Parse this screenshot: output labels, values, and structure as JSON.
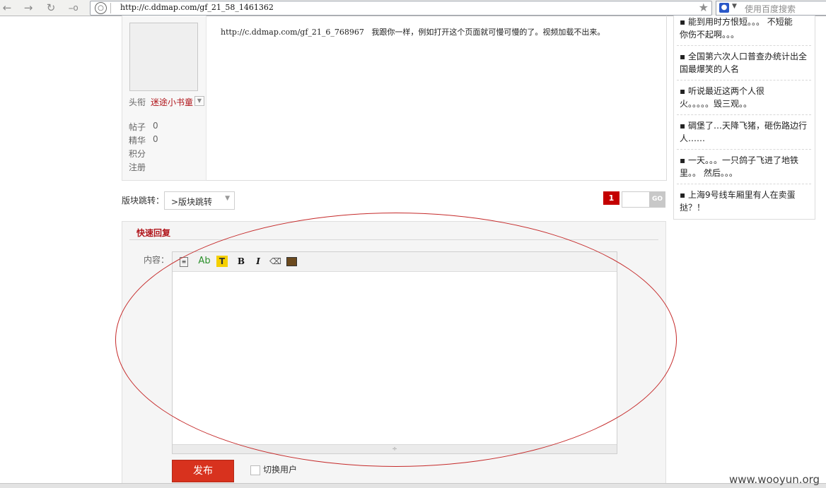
{
  "browser": {
    "url": "http://c.ddmap.com/gf_21_58_1461362",
    "search_placeholder": "使用百度搜索",
    "icons": [
      "back-arrow-icon",
      "forward-arrow-icon",
      "reload-icon",
      "key-icon",
      "globe-icon",
      "star-icon",
      "baidu-paw-icon"
    ]
  },
  "profile": {
    "title_label": "头衔",
    "title_value": "迷途小书童",
    "stats": [
      {
        "label": "帖子",
        "value": "0"
      },
      {
        "label": "精华",
        "value": "0"
      },
      {
        "label": "积分",
        "value": ""
      },
      {
        "label": "注册",
        "value": ""
      }
    ]
  },
  "post": {
    "link": "http://c.ddmap.com/gf_21_6_768967",
    "text": "我跟你一样，例如打开这个页面就可慢可慢的了。视频加载不出来。"
  },
  "sidebar": {
    "items": [
      {
        "line1": "▪ 能到用时方恨短。。。 不短能",
        "line2": "你伤不起啊。。。"
      },
      {
        "line1": "▪ 全国第六次人口普查办统计出全",
        "line2": "国最爆笑的人名"
      },
      {
        "line1": "▪ 听说最近这两个人很",
        "line2": "火。。。。。毁三观。。"
      },
      {
        "line1": "▪ 碉堡了…天降飞猪，砸伤路边行",
        "line2": "人……"
      },
      {
        "line1": "▪ 一天。。。一只鸽子飞进了地铁",
        "line2": "里。。 然后。。。"
      },
      {
        "line1": "▪ 上海9号线车厢里有人在卖蛋",
        "line2": "挞？！"
      }
    ]
  },
  "forum_jump": {
    "label": "版块跳转：",
    "selected": ">版块跳转"
  },
  "pagination": {
    "current": "1",
    "go_label": "GO"
  },
  "quick_reply": {
    "title": "快速回复",
    "content_label": "内容：",
    "toolbar_icons": [
      "paste-icon",
      "font-color-icon",
      "background-color-icon",
      "bold-icon",
      "italic-icon",
      "eraser-icon",
      "insert-image-icon"
    ],
    "toolbar_glyphs": {
      "font": "Ab",
      "bg": "T",
      "bold": "B",
      "italic": "I"
    },
    "submit_label": "发布",
    "switch_user_label": "切换用户"
  },
  "watermark": "www.wooyun.org",
  "colors": {
    "accent_red": "#b0141a",
    "button_red": "#d8321e",
    "annotation_ellipse": "#c52a2a"
  }
}
